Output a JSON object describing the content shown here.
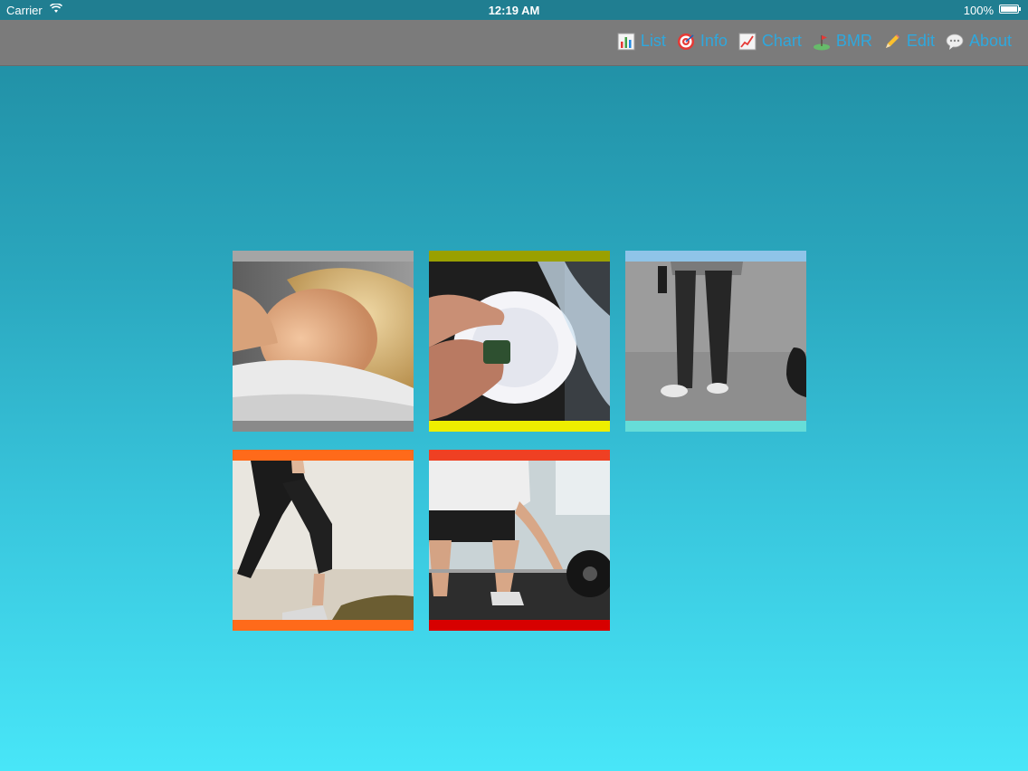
{
  "status_bar": {
    "carrier": "Carrier",
    "time": "12:19 AM",
    "battery": "100%"
  },
  "navbar": {
    "items": [
      {
        "label": "List",
        "icon": "bar-chart-icon"
      },
      {
        "label": "Info",
        "icon": "target-icon"
      },
      {
        "label": "Chart",
        "icon": "line-chart-icon"
      },
      {
        "label": "BMR",
        "icon": "golf-icon"
      },
      {
        "label": "Edit",
        "icon": "pencil-icon"
      },
      {
        "label": "About",
        "icon": "speech-bubble-icon"
      }
    ],
    "label_color": "#2ea8de"
  },
  "tiles": [
    {
      "photo": "sleeping-person",
      "band_top": "#a5a5a5",
      "band_bottom": "#8a8a8a"
    },
    {
      "photo": "washing-dishes",
      "band_top": "#9aa000",
      "band_bottom": "#eeee00"
    },
    {
      "photo": "walking-person",
      "band_top": "#8fc4e8",
      "band_bottom": "#66ddd8"
    },
    {
      "photo": "running-legs",
      "band_top": "#ff6a1a",
      "band_bottom": "#ff6a1a"
    },
    {
      "photo": "weightlifting",
      "band_top": "#ef4023",
      "band_bottom": "#d70000"
    }
  ]
}
